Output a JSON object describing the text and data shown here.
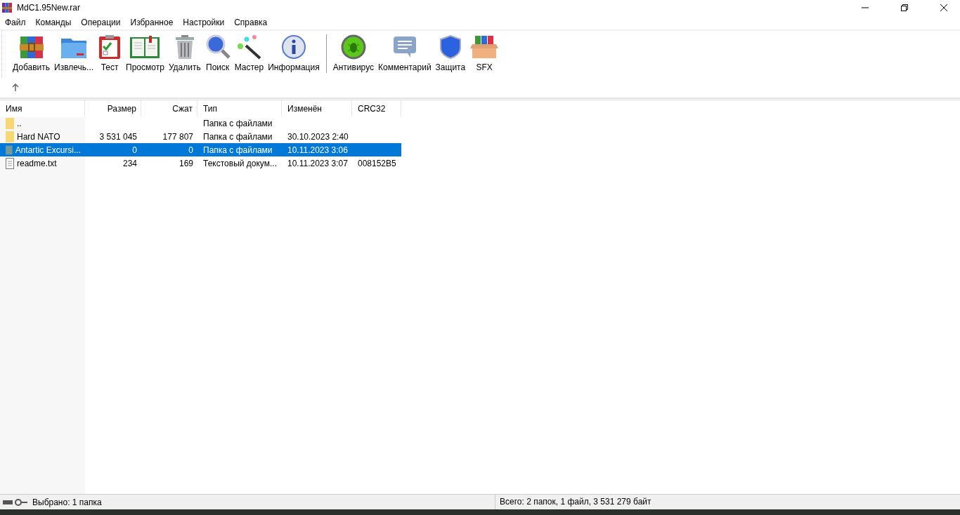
{
  "window": {
    "title": "MdC1.95New.rar"
  },
  "menu": [
    "Файл",
    "Команды",
    "Операции",
    "Избранное",
    "Настройки",
    "Справка"
  ],
  "toolbar": {
    "groups": [
      [
        {
          "label": "Добавить",
          "kind": "add"
        },
        {
          "label": "Извлечь...",
          "kind": "extract"
        },
        {
          "label": "Тест",
          "kind": "test"
        },
        {
          "label": "Просмотр",
          "kind": "view"
        },
        {
          "label": "Удалить",
          "kind": "delete"
        },
        {
          "label": "Поиск",
          "kind": "find"
        },
        {
          "label": "Мастер",
          "kind": "wizard"
        },
        {
          "label": "Информация",
          "kind": "info"
        }
      ],
      [
        {
          "label": "Антивирус",
          "kind": "antivirus"
        },
        {
          "label": "Комментарий",
          "kind": "comment"
        },
        {
          "label": "Защита",
          "kind": "protect"
        },
        {
          "label": "SFX",
          "kind": "sfx"
        }
      ]
    ]
  },
  "table": {
    "columns": [
      "Имя",
      "Размер",
      "Сжат",
      "Тип",
      "Изменён",
      "CRC32"
    ],
    "rows": [
      {
        "kind": "folder",
        "selected": false,
        "cells": [
          "..",
          "",
          "",
          "Папка с файлами",
          "",
          ""
        ]
      },
      {
        "kind": "folder",
        "selected": false,
        "cells": [
          "Hard NATO",
          "3 531 045",
          "177 807",
          "Папка с файлами",
          "30.10.2023 2:40",
          ""
        ]
      },
      {
        "kind": "folder",
        "selected": true,
        "cells": [
          "Antartic Excursi...",
          "0",
          "0",
          "Папка с файлами",
          "10.11.2023 3:06",
          ""
        ]
      },
      {
        "kind": "file",
        "selected": false,
        "cells": [
          "readme.txt",
          "234",
          "169",
          "Текстовый докум...",
          "10.11.2023 3:07",
          "008152B5"
        ]
      }
    ]
  },
  "status_bar": {
    "left": "Выбрано: 1 папка",
    "right": "Всего: 2 папок, 1 файл, 3 531 279 байт"
  }
}
